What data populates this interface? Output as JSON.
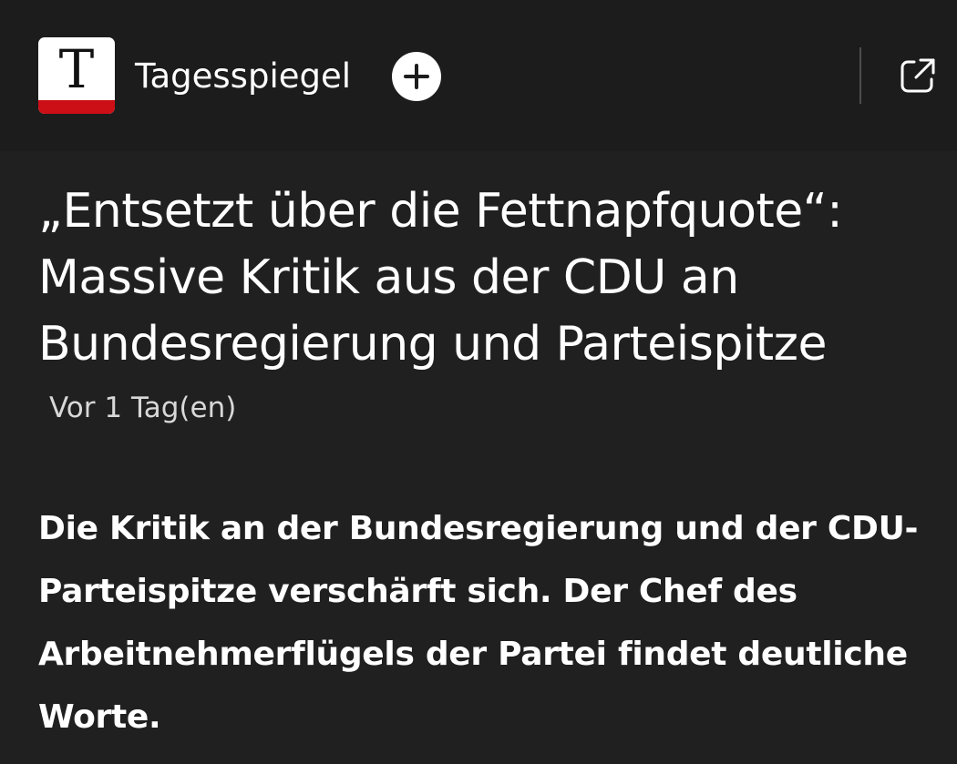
{
  "header": {
    "logo_letter": "T",
    "source_name": "Tagesspiegel",
    "follow_icon": "plus-circle-icon",
    "open_icon": "open-external-icon"
  },
  "article": {
    "headline": "„Entsetzt über die Fettnapfquote“: Massive Kritik aus der CDU an Bundesregierung und Parteispitze",
    "timestamp": "Vor 1 Tag(en)",
    "summary": "Die Kritik an der Bundesregierung und der CDU-Parteispitze verschärft sich. Der Chef des Arbeitnehmerflügels der Partei findet deutliche Worte."
  },
  "colors": {
    "background": "#202020",
    "header_background": "#1c1c1c",
    "logo_stripe": "#cc0f17",
    "text": "#ffffff",
    "muted_text": "#d8d8d8"
  }
}
